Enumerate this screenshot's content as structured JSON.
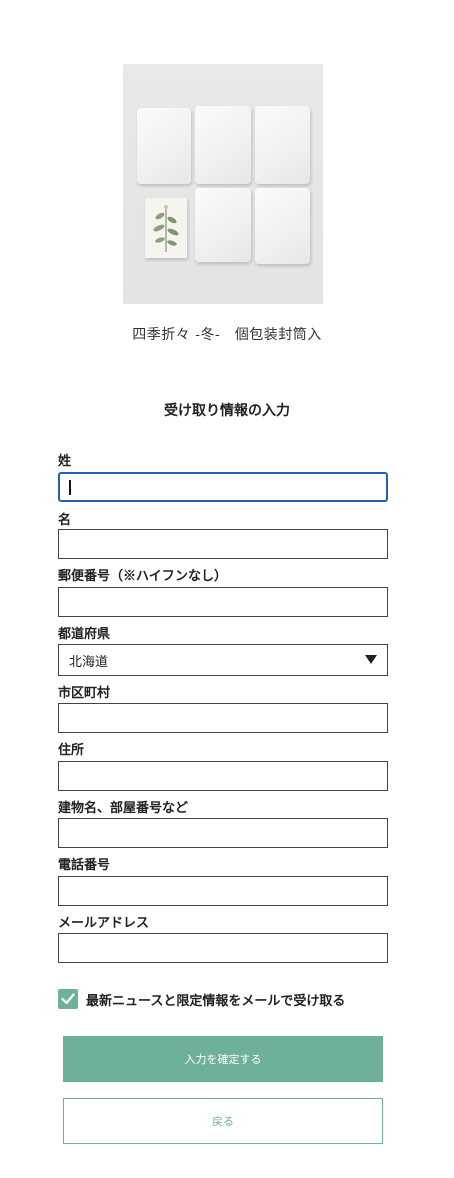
{
  "product": {
    "name": "四季折々 -冬-　個包装封筒入"
  },
  "form": {
    "title": "受け取り情報の入力",
    "fields": {
      "last_name": {
        "label": "姓",
        "value": ""
      },
      "first_name": {
        "label": "名",
        "value": ""
      },
      "postal_code": {
        "label": "郵便番号（※ハイフンなし）",
        "value": ""
      },
      "prefecture": {
        "label": "都道府県",
        "value": "北海道"
      },
      "city": {
        "label": "市区町村",
        "value": ""
      },
      "address": {
        "label": "住所",
        "value": ""
      },
      "building": {
        "label": "建物名、部屋番号など",
        "value": ""
      },
      "phone": {
        "label": "電話番号",
        "value": ""
      },
      "email": {
        "label": "メールアドレス",
        "value": ""
      }
    },
    "newsletter": {
      "label": "最新ニュースと限定情報をメールで受け取る",
      "checked": true
    },
    "buttons": {
      "submit": "入力を確定する",
      "back": "戻る"
    }
  },
  "colors": {
    "accent": "#6fb198",
    "focus": "#1f62b6"
  }
}
